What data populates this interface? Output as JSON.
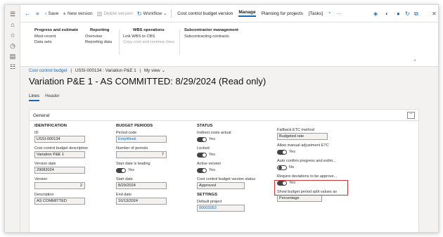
{
  "rail": {
    "icons": [
      "hamburger-icon",
      "home-icon",
      "star-icon",
      "clock-icon",
      "modules-icon",
      "list-icon"
    ]
  },
  "cmdbar": {
    "save": "Save",
    "new_version": "New version",
    "delete_version": "Delete version",
    "workflow": "Workflow",
    "tab_ccbv": "Cost control budget version",
    "tab_manage": "Manage",
    "tab_planning": "Planning for projects",
    "tab_tasks": "[Tasks]"
  },
  "action": {
    "g1": {
      "title": "Progress and estimate",
      "items": [
        "Most recent",
        "Data sets"
      ]
    },
    "g2": {
      "title": "Reporting",
      "items": [
        "Overview",
        "Reporting data"
      ]
    },
    "g3": {
      "title": "WBS operations",
      "items": [
        "Link WBS to CBS",
        "Copy cost and revenue lines"
      ]
    },
    "g4": {
      "title": "Subcontractor management",
      "items": [
        "Subcontracting contracts"
      ]
    }
  },
  "breadcrumb": {
    "module": "Cost control budget",
    "sep1": "|",
    "record": "USSI-000134 : Variation P&E 1",
    "sep2": "|",
    "view": "My view"
  },
  "title": "Variation P&E 1 - AS COMMITTED: 8/29/2024 (Read only)",
  "tabs": [
    "Lines",
    "Header"
  ],
  "general": {
    "title": "General",
    "identification": {
      "heading": "IDENTIFICATION",
      "id_label": "ID",
      "id_value": "USSI-000134",
      "desc_label": "Cost control budget description",
      "desc_value": "Variation P&E 1",
      "vdate_label": "Version date",
      "vdate_value": "29082024",
      "version_label": "Version",
      "version_value": "2",
      "description_label": "Description",
      "description_value": "AS COMMITTED"
    },
    "budget_periods": {
      "heading": "BUDGET PERIODS",
      "pcode_label": "Period code",
      "pcode_value": "EmpWeek",
      "nperiods_label": "Number of periods",
      "nperiods_value": "7",
      "leading_label": "Start date is leading",
      "leading_value": "Yes",
      "start_label": "Start date",
      "start_value": "8/29/2024",
      "end_label": "End date",
      "end_value": "10/13/2024"
    },
    "status": {
      "heading": "STATUS",
      "indirect_label": "Indirect costs actual",
      "indirect_value": "Yes",
      "locked_label": "Locked",
      "locked_value": "Yes",
      "active_label": "Active version",
      "active_value": "Yes",
      "vstatus_label": "Cost control budget version status",
      "vstatus_value": "Approved"
    },
    "settings": {
      "heading": "SETTINGS",
      "dproject_label": "Default project",
      "dproject_value": "00002053"
    },
    "right": {
      "etc_label": "Fallback ETC method",
      "etc_value": "Budgeted rate",
      "manual_label": "Allow manual adjustment ETC",
      "manual_value": "Yes",
      "autoconfirm_label": "Auto confirm progress and estim...",
      "autoconfirm_value": "No",
      "deviations_label": "Require deviations to be approve...",
      "deviations_value": "Yes",
      "split_label": "Show budget period split values as",
      "split_value": "Percentage"
    }
  },
  "colors": {
    "accent": "#0f6cbd",
    "highlight": "#d13438"
  }
}
